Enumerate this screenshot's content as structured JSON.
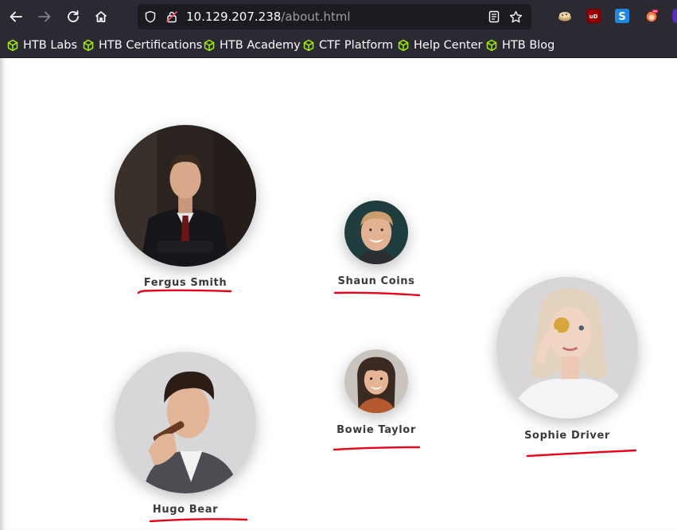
{
  "browser": {
    "url_host": "10.129.207.238",
    "url_path": "/about.html",
    "icons": {
      "back": "back-arrow-icon",
      "forward": "forward-arrow-icon",
      "reload": "reload-icon",
      "home": "home-icon",
      "shield": "tracking-protection-shield-icon",
      "insecure": "insecure-connection-lock-icon",
      "reader": "reader-view-icon",
      "bookmark": "bookmark-star-icon"
    },
    "extensions": [
      {
        "name": "cookie-extension-icon",
        "color": "#c9a46a"
      },
      {
        "name": "ublock-origin-icon",
        "label": "uD",
        "color": "#800000"
      },
      {
        "name": "stylus-extension-icon",
        "label": "S",
        "color": "#1e88e5"
      },
      {
        "name": "foxyproxy-extension-icon",
        "color": "#ff7139"
      }
    ]
  },
  "bookmarks": [
    {
      "label": "HTB Labs"
    },
    {
      "label": "HTB Certifications"
    },
    {
      "label": "HTB Academy"
    },
    {
      "label": "CTF Platform"
    },
    {
      "label": "Help Center"
    },
    {
      "label": "HTB Blog"
    }
  ],
  "bookmark_icon_color": "#9fef00",
  "accent_underline_color": "#e8001a",
  "team": [
    {
      "name": "Fergus Smith"
    },
    {
      "name": "Shaun Coins"
    },
    {
      "name": "Hugo Bear"
    },
    {
      "name": "Bowie Taylor"
    },
    {
      "name": "Sophie Driver"
    }
  ]
}
